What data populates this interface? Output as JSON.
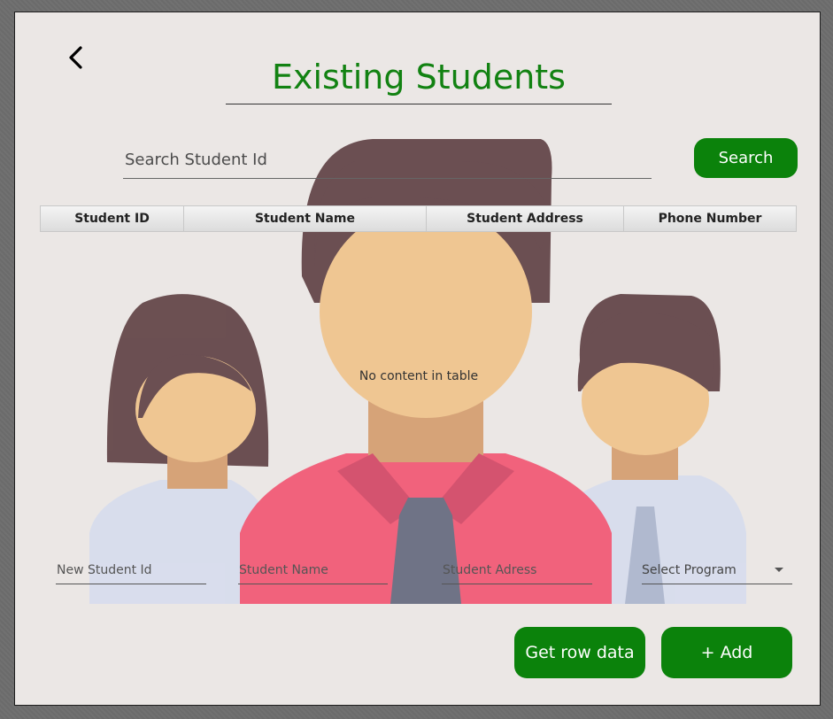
{
  "header": {
    "title": "Existing Students",
    "back_icon": "chevron-left-icon"
  },
  "search": {
    "placeholder": "Search Student Id",
    "button_label": "Search"
  },
  "table": {
    "columns": [
      "Student ID",
      "Student Name",
      "Student Address",
      "Phone Number"
    ],
    "rows": [],
    "empty_message": "No content in table"
  },
  "form": {
    "student_id_placeholder": "New Student Id",
    "student_name_placeholder": "Student Name",
    "student_address_placeholder": "Student Adress",
    "program_select": {
      "selected": "Select Program"
    }
  },
  "actions": {
    "get_row_label": "Get row data",
    "add_label": "+ Add"
  },
  "colors": {
    "accent": "#0b820b",
    "title": "#128212",
    "background": "#ebe7e5"
  }
}
